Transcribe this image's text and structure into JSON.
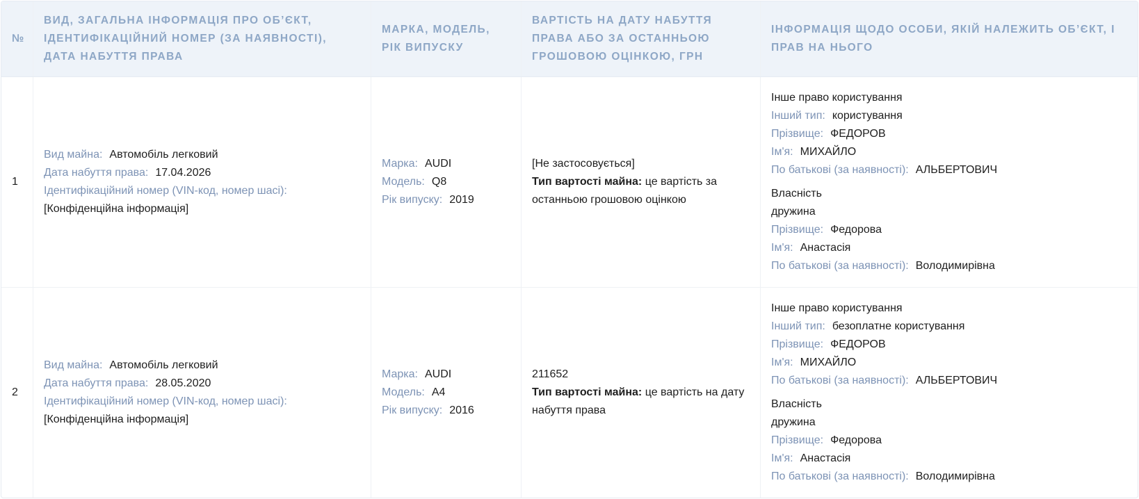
{
  "headers": {
    "num": "№",
    "object": "ВИД, ЗАГАЛЬНА ІНФОРМАЦІЯ ПРО ОБ’ЄКТ, ІДЕНТИФІКАЦІЙНИЙ НОМЕР (ЗА НАЯВНОСТІ), ДАТА НАБУТТЯ ПРАВА",
    "brand": "МАРКА, МОДЕЛЬ, РІК ВИПУСКУ",
    "value": "ВАРТІСТЬ НА ДАТУ НАБУТТЯ ПРАВА АБО ЗА ОСТАННЬОЮ ГРОШОВОЮ ОЦІНКОЮ, ГРН",
    "owner": "ІНФОРМАЦІЯ ЩОДО ОСОБИ, ЯКІЙ НАЛЕЖИТЬ ОБ’ЄКТ, І ПРАВ НА НЬОГО"
  },
  "labels": {
    "property_type": "Вид майна:",
    "acquired_date": "Дата набуття права:",
    "vin": "Ідентифікаційний номер (VIN-код, номер шасі):",
    "make": "Марка:",
    "model": "Модель:",
    "year": "Рік випуску:",
    "value_type": "Тип вартості майна:",
    "other_type": "Інший тип:",
    "surname": "Прізвище:",
    "name": "Ім'я:",
    "patronymic": "По батькові (за наявності):"
  },
  "rows": [
    {
      "num": "1",
      "property_type": "Автомобіль легковий",
      "acquired_date": "17.04.2026",
      "vin": "[Конфіденційна інформація]",
      "make": "AUDI",
      "model": "Q8",
      "year": "2019",
      "value": "[Не застосовується]",
      "value_type": "це вартість за останньою грошовою оцінкою",
      "right1": {
        "title": "Інше право користування",
        "other_type": "користування",
        "surname": "ФЕДОРОВ",
        "name": "МИХАЙЛО",
        "patronymic": "АЛЬБЕРТОВИЧ"
      },
      "right2": {
        "title": "Власність",
        "relation": "дружина",
        "surname": "Федорова",
        "name": "Анастасія",
        "patronymic": "Володимирівна"
      }
    },
    {
      "num": "2",
      "property_type": "Автомобіль легковий",
      "acquired_date": "28.05.2020",
      "vin": "[Конфіденційна інформація]",
      "make": "AUDI",
      "model": "A4",
      "year": "2016",
      "value": "211652",
      "value_type": "це вартість на дату набуття права",
      "right1": {
        "title": "Інше право користування",
        "other_type": "безоплатне користування",
        "surname": "ФЕДОРОВ",
        "name": "МИХАЙЛО",
        "patronymic": "АЛЬБЕРТОВИЧ"
      },
      "right2": {
        "title": "Власність",
        "relation": "дружина",
        "surname": "Федорова",
        "name": "Анастасія",
        "patronymic": "Володимирівна"
      }
    }
  ]
}
